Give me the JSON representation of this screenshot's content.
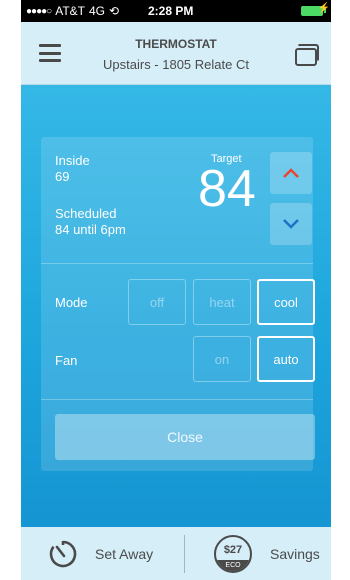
{
  "status_bar": {
    "signal_dots": "●●●●○",
    "carrier": "AT&T",
    "network": "4G",
    "time": "2:28 PM"
  },
  "header": {
    "title": "THERMOSTAT",
    "subtitle": "Upstairs - 1805 Relate Ct"
  },
  "thermostat": {
    "inside_label": "Inside",
    "inside_value": "69",
    "scheduled_label": "Scheduled",
    "scheduled_value": "84 until 6pm",
    "target_label": "Target",
    "target_value": "84",
    "mode": {
      "label": "Mode",
      "options": [
        "off",
        "heat",
        "cool"
      ],
      "selected": "cool"
    },
    "fan": {
      "label": "Fan",
      "options": [
        "on",
        "auto"
      ],
      "selected": "auto"
    },
    "close_label": "Close"
  },
  "bottom_bar": {
    "away_label": "Set Away",
    "eco_amount": "$27",
    "eco_tag": "ECO",
    "savings_label": "Savings"
  },
  "colors": {
    "up_arrow": "#e8452f",
    "down_arrow": "#1a73c7",
    "header_bg": "#d5eef8",
    "main_bg": "#22a9df"
  },
  "icons": [
    "menu-icon",
    "devices-icon",
    "chevron-up-icon",
    "chevron-down-icon",
    "set-away-timer-icon"
  ]
}
